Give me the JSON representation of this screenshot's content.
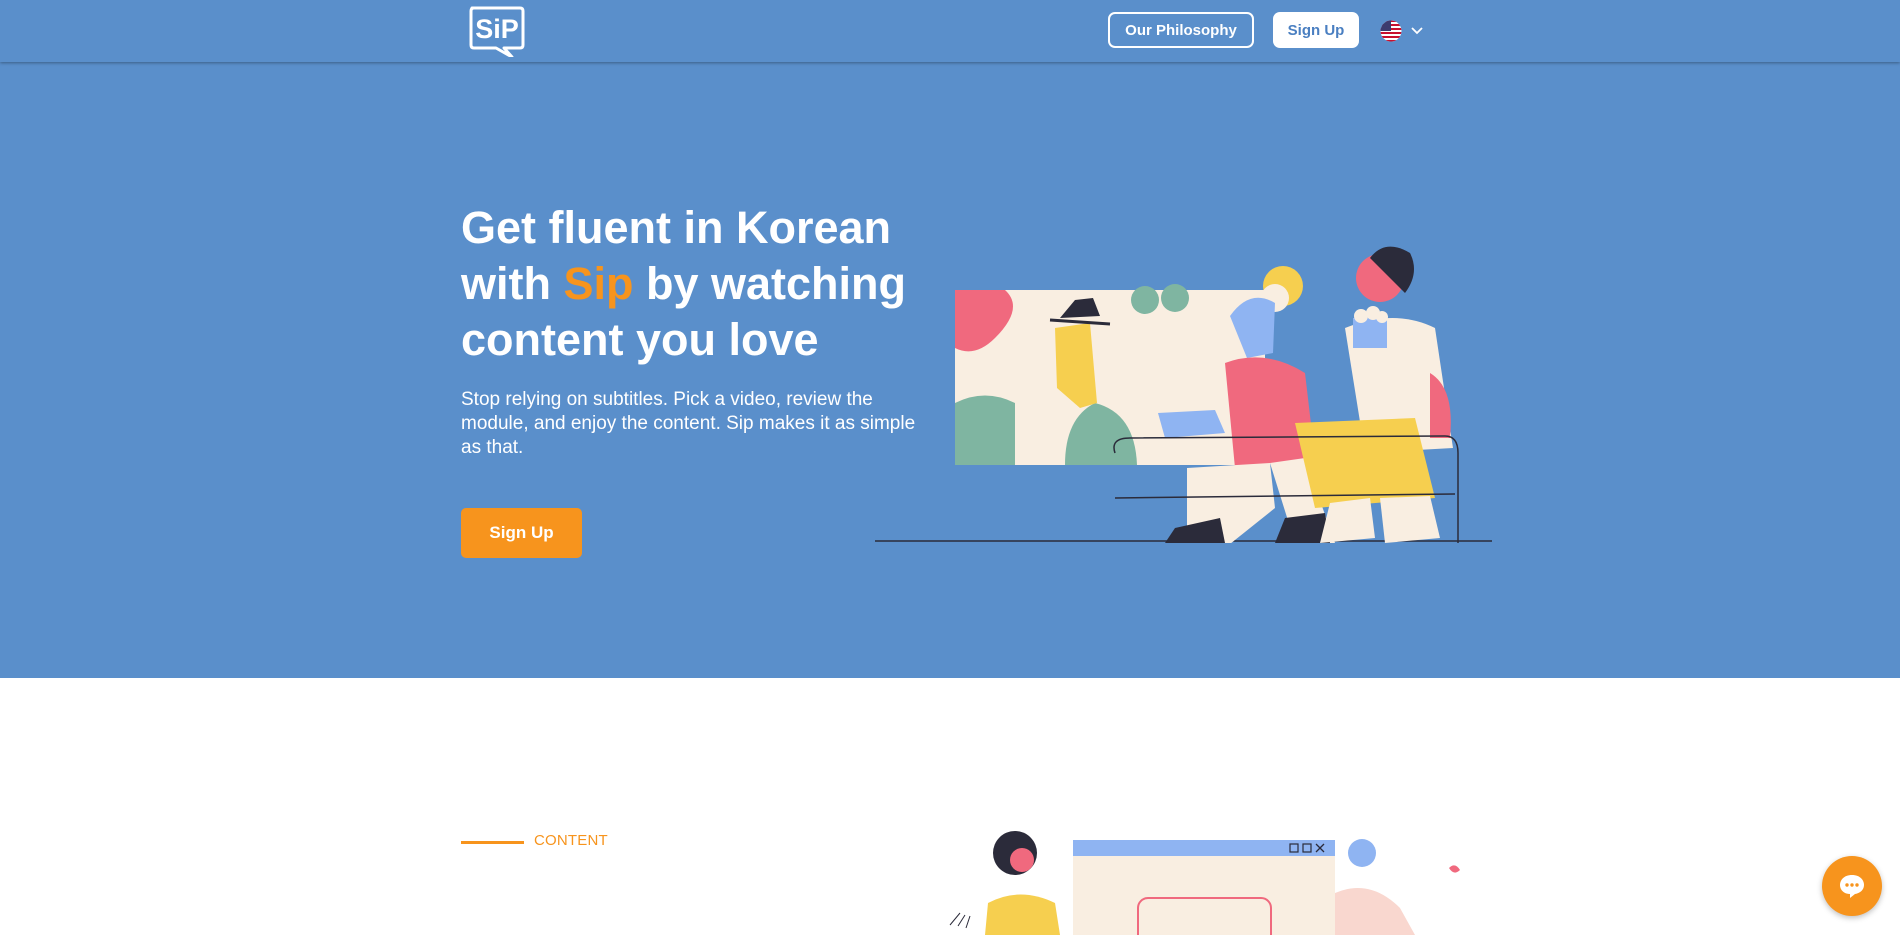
{
  "header": {
    "logo_text": "SiP",
    "philosophy_label": "Our Philosophy",
    "signup_label": "Sign Up",
    "language_icon": "us-flag-icon"
  },
  "hero": {
    "title_part1": "Get fluent in Korean with ",
    "title_accent": "Sip",
    "title_part2": " by watching content you love",
    "description": "Stop relying on subtitles. Pick a video, review the module, and enjoy the content. Sip makes it as simple as that.",
    "cta_label": "Sign Up"
  },
  "content_section": {
    "label": "CONTENT"
  },
  "colors": {
    "hero_bg": "#5a8fcb",
    "accent_orange": "#f7941d",
    "white": "#ffffff"
  },
  "chat": {
    "icon": "chat-bubble-icon"
  }
}
